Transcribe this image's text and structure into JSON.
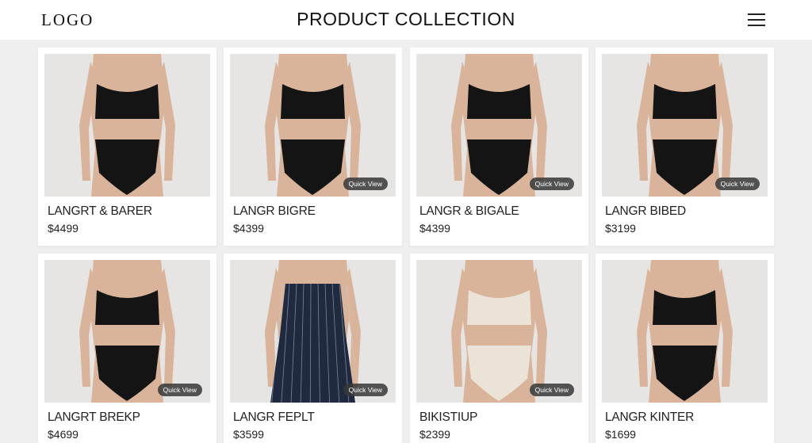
{
  "header": {
    "logo": "LOGO",
    "title": "PRODUCT COLLECTION",
    "menu_icon": "hamburger-menu-icon"
  },
  "products": [
    {
      "name": "LANGRT & BARER",
      "price": "$4499",
      "quick_view": "",
      "top": "black",
      "bottom": "black"
    },
    {
      "name": "LANGR BIGRE",
      "price": "$4399",
      "quick_view": "Quick View",
      "top": "black",
      "bottom": "black"
    },
    {
      "name": "LANGR & BIGALE",
      "price": "$4399",
      "quick_view": "Quick View",
      "top": "black",
      "bottom": "black"
    },
    {
      "name": "LANGR BIBED",
      "price": "$3199",
      "quick_view": "Quick View",
      "top": "black",
      "bottom": "black"
    },
    {
      "name": "LANGRT BREKP",
      "price": "$4699",
      "quick_view": "Quick View",
      "top": "black",
      "bottom": "black"
    },
    {
      "name": "LANGR FEPLT",
      "price": "$3599",
      "quick_view": "Quick View",
      "top": "navy-stripe",
      "bottom": "navy-stripe"
    },
    {
      "name": "BIKISTIUP",
      "price": "$2399",
      "quick_view": "Quick View",
      "top": "ivory",
      "bottom": "ivory"
    },
    {
      "name": "LANGR KINTER",
      "price": "$1699",
      "quick_view": "",
      "top": "black",
      "bottom": "black"
    }
  ],
  "colors": {
    "page_background": "#efefef",
    "card_background": "#ffffff",
    "photo_background": "#e6e5e3",
    "skin": "#d9b49a",
    "garment_black": "#141414",
    "garment_ivory": "#ece3d8",
    "garment_navy": "#1f2a40"
  }
}
